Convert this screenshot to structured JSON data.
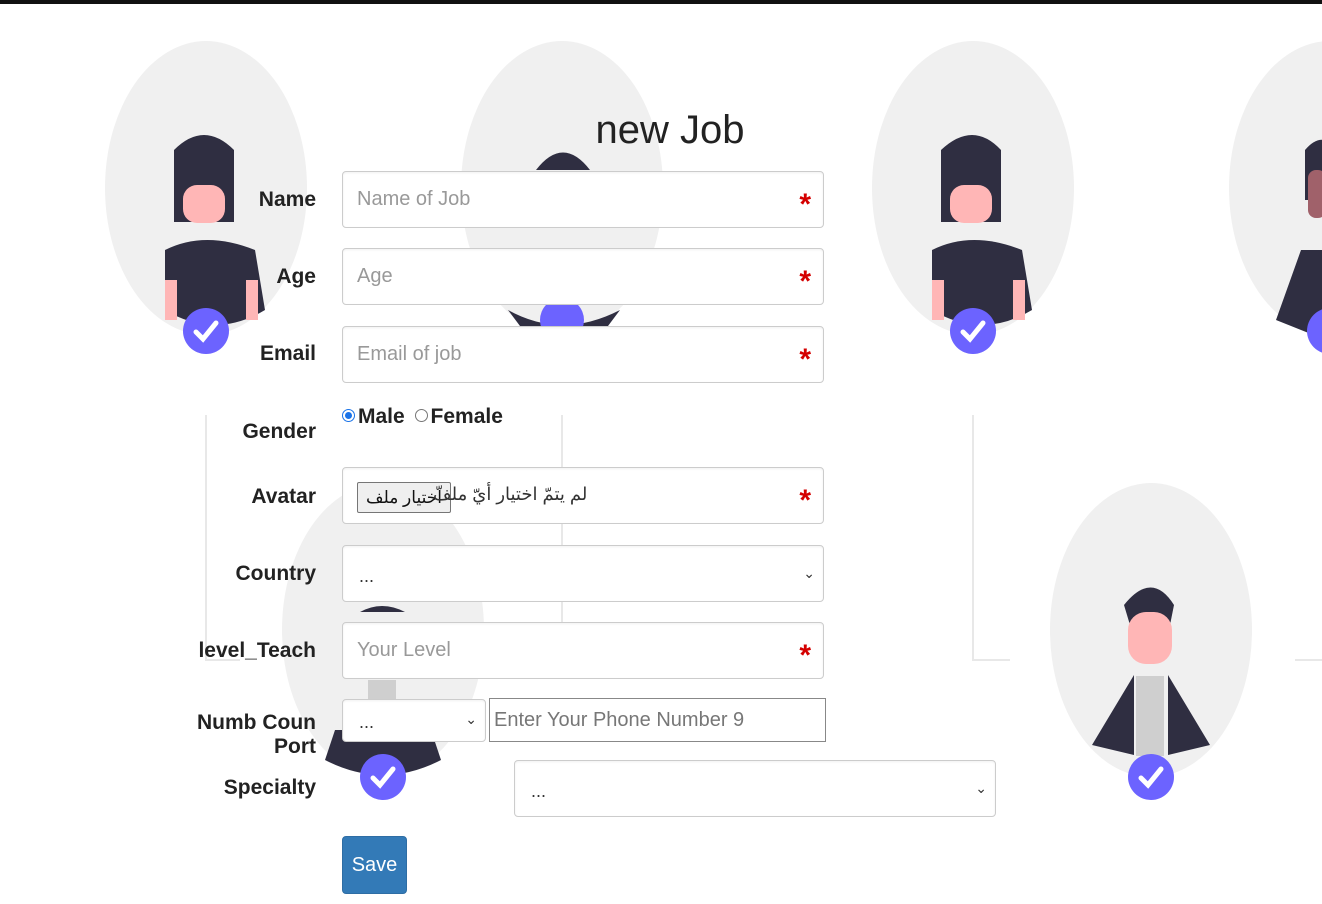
{
  "page": {
    "title": "new Job"
  },
  "form": {
    "name": {
      "label": "Name",
      "placeholder": "Name of Job",
      "required": "*"
    },
    "age": {
      "label": "Age",
      "placeholder": "Age",
      "required": "*"
    },
    "email": {
      "label": "Email",
      "placeholder": "Email of job",
      "required": "*"
    },
    "gender": {
      "label": "Gender",
      "options": [
        "Male",
        "Female"
      ],
      "selected": "Male"
    },
    "avatar": {
      "label": "Avatar",
      "button": "اختيار ملف",
      "status": "لم يتمّ اختيار أيّ ملفّ",
      "required": "*"
    },
    "country": {
      "label": "Country",
      "value": "..."
    },
    "level": {
      "label": "level_Teach",
      "placeholder": "Your Level",
      "required": "*"
    },
    "phone": {
      "label": "Numb Coun Port",
      "code_value": "...",
      "placeholder": "Enter Your Phone Number 9"
    },
    "specialty": {
      "label": "Specialty",
      "value": "..."
    },
    "save_label": "Save"
  },
  "colors": {
    "accent": "#337ab7",
    "required": "#d40000",
    "badge": "#6c63ff",
    "hair": "#2f2e41",
    "skin": "#ffb6b6"
  },
  "icons": {
    "avatar_badge": "check-badge-icon",
    "select": "chevron-down-icon"
  }
}
